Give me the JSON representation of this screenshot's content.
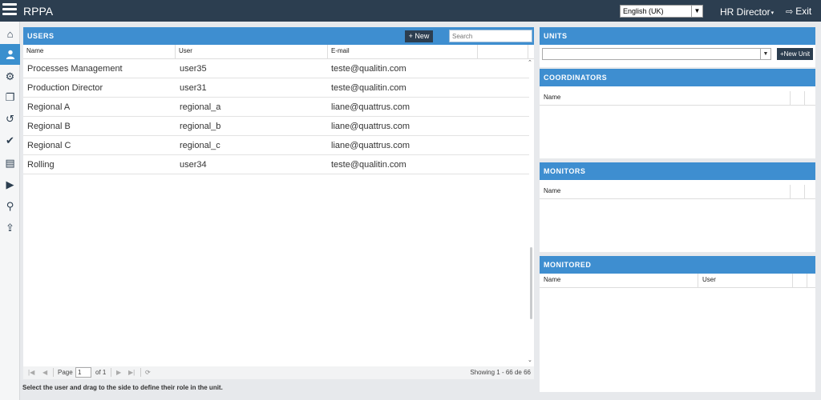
{
  "topbar": {
    "app_title": "RPPA",
    "language": "English (UK)",
    "role": "HR Director",
    "exit_label": "Exit"
  },
  "sidebar": {
    "items": [
      {
        "icon": "home-icon",
        "glyph": "⌂"
      },
      {
        "icon": "user-icon",
        "glyph": "👤"
      },
      {
        "icon": "gears-icon",
        "glyph": "⚙"
      },
      {
        "icon": "copy-icon",
        "glyph": "❐"
      },
      {
        "icon": "history-icon",
        "glyph": "↺"
      },
      {
        "icon": "check-circle-icon",
        "glyph": "✔"
      },
      {
        "icon": "document-icon",
        "glyph": "▤"
      },
      {
        "icon": "play-icon",
        "glyph": "▶"
      },
      {
        "icon": "map-marker-icon",
        "glyph": "⚲"
      },
      {
        "icon": "upload-icon",
        "glyph": "⇪"
      }
    ]
  },
  "users": {
    "title": "USERS",
    "new_label": "+ New",
    "search_placeholder": "Search",
    "columns": [
      "Name",
      "User",
      "E-mail"
    ],
    "rows": [
      {
        "name": "Processes Management",
        "user": "user35",
        "email": "teste@qualitin.com"
      },
      {
        "name": "Production Director",
        "user": "user31",
        "email": "teste@qualitin.com"
      },
      {
        "name": "Regional A",
        "user": "regional_a",
        "email": "liane@quattrus.com"
      },
      {
        "name": "Regional B",
        "user": "regional_b",
        "email": "liane@quattrus.com"
      },
      {
        "name": "Regional C",
        "user": "regional_c",
        "email": "liane@quattrus.com"
      },
      {
        "name": "Rolling",
        "user": "user34",
        "email": "teste@qualitin.com"
      }
    ]
  },
  "pager": {
    "page_label": "Page",
    "page_value": "1",
    "of_label": "of 1",
    "showing": "Showing 1 - 66 de 66"
  },
  "hint": "Select the user and drag to the side to define their role in the unit.",
  "units": {
    "title": "UNITS",
    "new_unit_label": "+New Unit"
  },
  "coordinators": {
    "title": "COORDINATORS",
    "col_name": "Name"
  },
  "monitors": {
    "title": "MONITORS",
    "col_name": "Name"
  },
  "monitored": {
    "title": "MONITORED",
    "col_name": "Name",
    "col_user": "User"
  },
  "colors": {
    "header_blue": "#3e8ed0",
    "topbar": "#2c3e50",
    "active_nav": "#3a8fce"
  }
}
